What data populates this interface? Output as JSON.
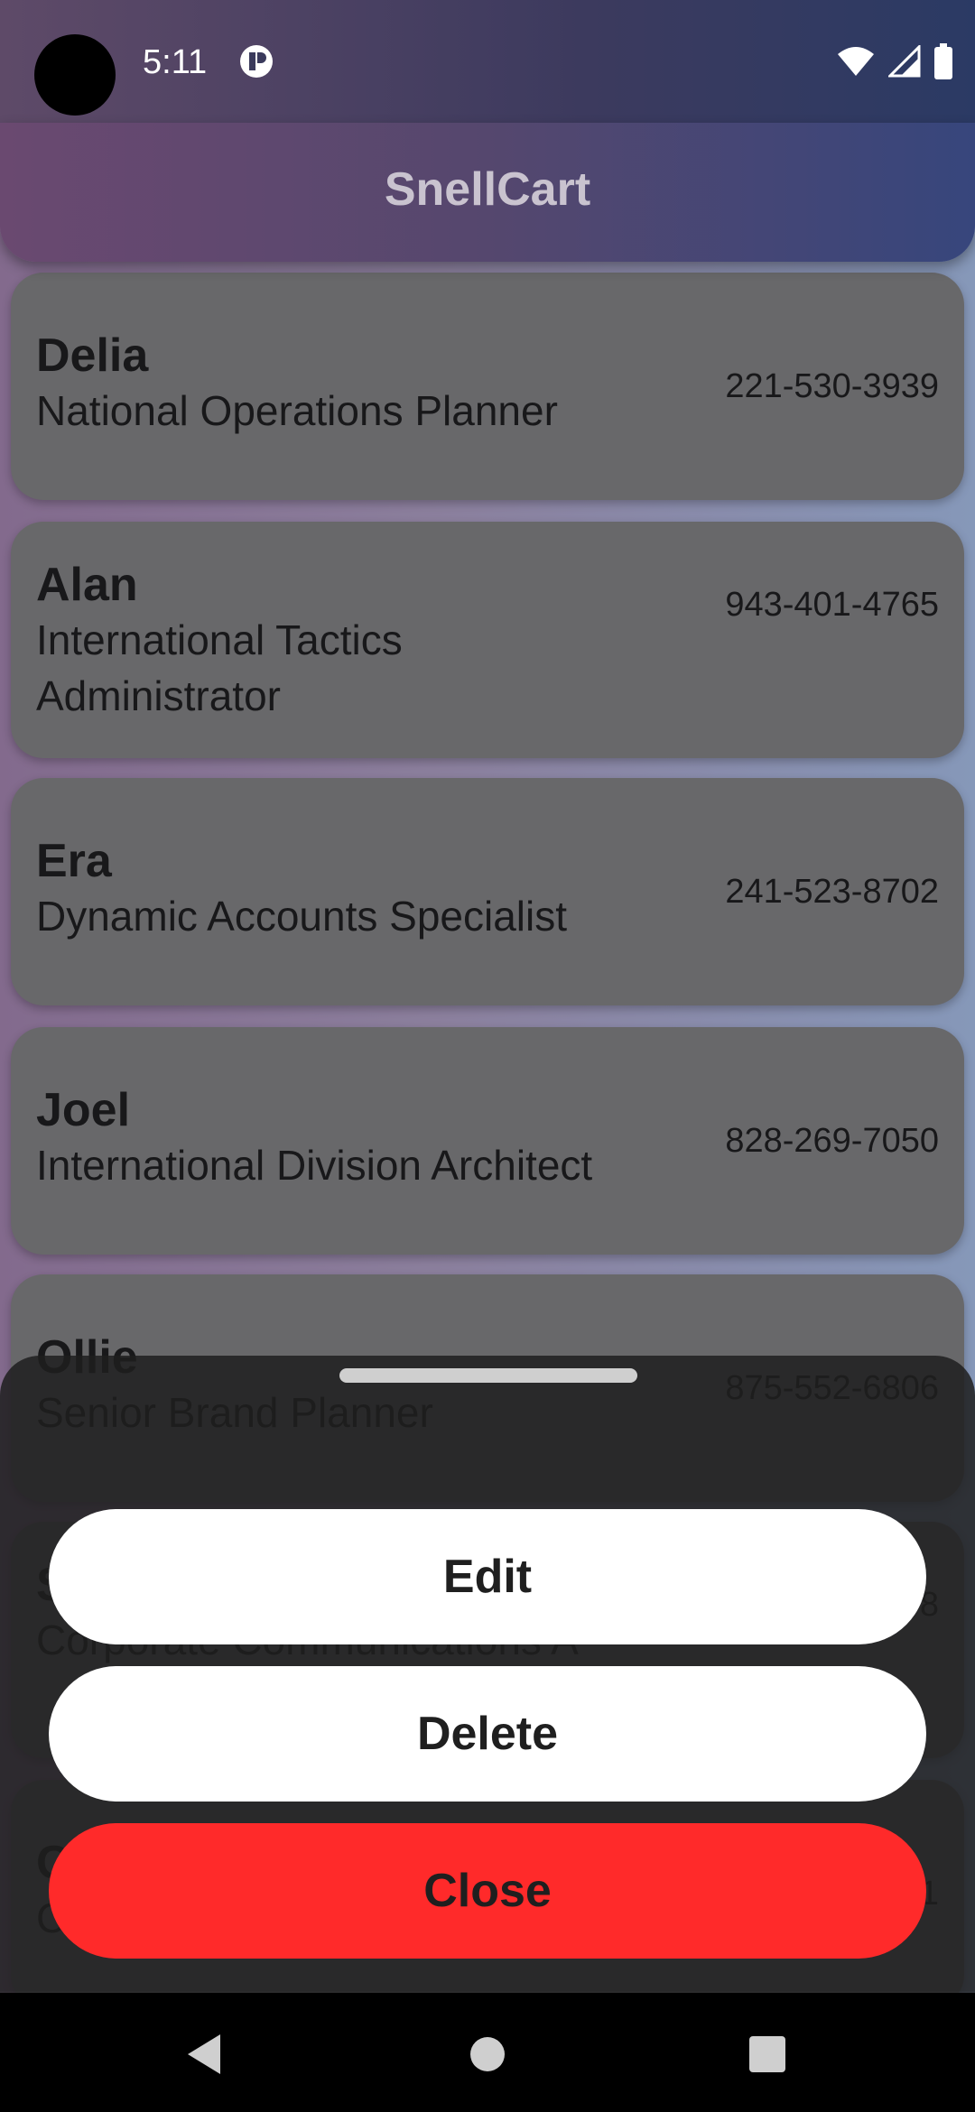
{
  "status_bar": {
    "time": "5:11",
    "icons": [
      "app-notification-icon",
      "wifi-icon",
      "signal-icon",
      "battery-icon"
    ]
  },
  "app_bar": {
    "title": "SnellCart"
  },
  "contacts": [
    {
      "name": "Delia",
      "role": "National Operations Planner",
      "phone": "221-530-3939"
    },
    {
      "name": "Alan",
      "role": "International Tactics Administrator",
      "phone": "943-401-4765"
    },
    {
      "name": "Era",
      "role": "Dynamic Accounts Specialist",
      "phone": "241-523-8702"
    },
    {
      "name": "Joel",
      "role": "International Division Architect",
      "phone": "828-269-7050"
    },
    {
      "name": "Ollie",
      "role": "Senior Brand Planner",
      "phone": "875-552-6806"
    },
    {
      "name": "S",
      "role": "Corporate Communications A",
      "phone": "8"
    },
    {
      "name": "C",
      "role": "C",
      "phone": "1"
    }
  ],
  "sheet": {
    "edit_label": "Edit",
    "delete_label": "Delete",
    "close_label": "Close",
    "close_color": "#ff2a2a"
  },
  "nav_bar": {
    "icons": [
      "back-icon",
      "home-icon",
      "recents-icon"
    ]
  }
}
